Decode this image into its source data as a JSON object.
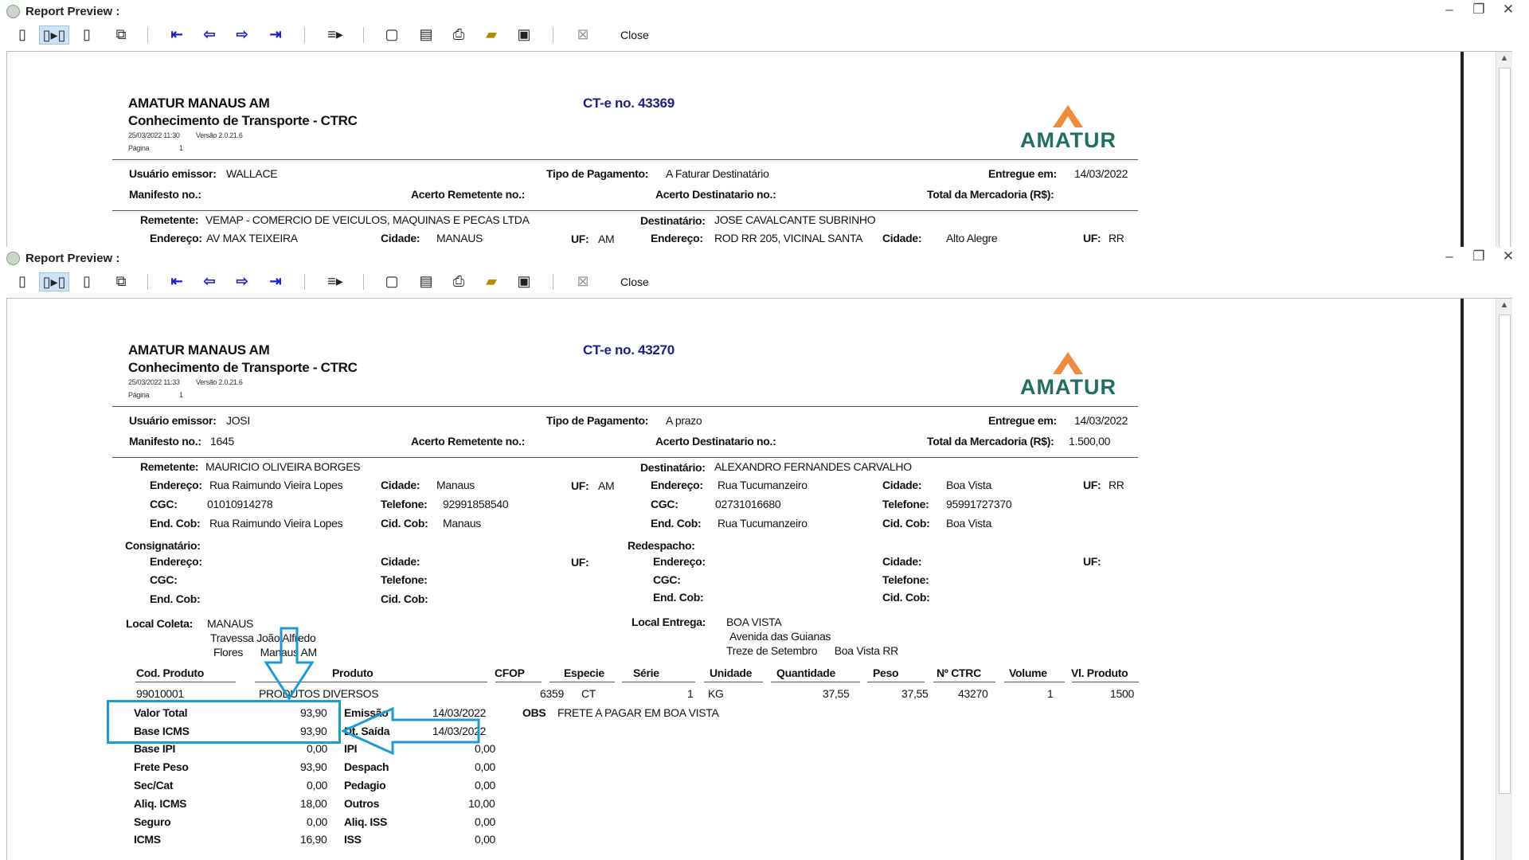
{
  "window": {
    "title": "Report Preview :",
    "close_label": "Close",
    "controls": {
      "minimize": "–",
      "restore": "❐",
      "close": "✕"
    }
  },
  "report1": {
    "company": "AMATUR MANAUS AM",
    "doc_title": "Conhecimento de Transporte - CTRC",
    "ct_number": "CT-e no. 43369",
    "datetime": "25/03/2022 11:30",
    "version": "Versão 2.0.21.6",
    "page_label": "Página",
    "page_num": "1",
    "logo_text": "AMATUR",
    "usuario_label": "Usuário emissor:",
    "usuario": "WALLACE",
    "tipo_pag_label": "Tipo de Pagamento:",
    "tipo_pag": "A Faturar Destinatário",
    "entregue_label": "Entregue em:",
    "entregue": "14/03/2022",
    "manifesto_label": "Manifesto no.:",
    "acerto_rem_label": "Acerto Remetente no.:",
    "acerto_dest_label": "Acerto Destinatario no.:",
    "total_merc_label": "Total da Mercadoria (R$):",
    "remetente_label": "Remetente:",
    "remetente": "VEMAP - COMERCIO DE VEICULOS, MAQUINAS E PECAS LTDA",
    "destinatario_label": "Destinatário:",
    "destinatario": "JOSE CAVALCANTE SUBRINHO",
    "endereco_label": "Endereço:",
    "rem_endereco": "AV MAX TEIXEIRA",
    "cidade_label": "Cidade:",
    "rem_cidade": "MANAUS",
    "uf_label": "UF:",
    "rem_uf": "AM",
    "dest_endereco": "ROD RR 205, VICINAL SANTA",
    "dest_cidade": "Alto Alegre",
    "dest_uf": "RR"
  },
  "report2": {
    "company": "AMATUR MANAUS AM",
    "doc_title": "Conhecimento de Transporte - CTRC",
    "ct_number": "CT-e no. 43270",
    "datetime": "25/03/2022 11:33",
    "version": "Versão 2.0.21.6",
    "page_label": "Página",
    "page_num": "1",
    "logo_text": "AMATUR",
    "usuario_label": "Usuário emissor:",
    "usuario": "JOSI",
    "tipo_pag_label": "Tipo de Pagamento:",
    "tipo_pag": "A prazo",
    "entregue_label": "Entregue em:",
    "entregue": "14/03/2022",
    "manifesto_label": "Manifesto no.:",
    "manifesto": "1645",
    "acerto_rem_label": "Acerto Remetente no.:",
    "acerto_dest_label": "Acerto Destinatario no.:",
    "total_merc_label": "Total da Mercadoria (R$):",
    "total_merc": "1.500,00",
    "remetente_label": "Remetente:",
    "remetente": "MAURICIO OLIVEIRA BORGES",
    "destinatario_label": "Destinatário:",
    "destinatario": "ALEXANDRO FERNANDES CARVALHO",
    "endereco_label": "Endereço:",
    "cidade_label": "Cidade:",
    "uf_label": "UF:",
    "cgc_label": "CGC:",
    "telefone_label": "Telefone:",
    "endcob_label": "End. Cob:",
    "cidcob_label": "Cid. Cob:",
    "rem": {
      "endereco": "Rua Raimundo Vieira Lopes",
      "cidade": "Manaus",
      "uf": "AM",
      "cgc": "01010914278",
      "telefone": "92991858540",
      "endcob": "Rua Raimundo Vieira Lopes",
      "cidcob": "Manaus"
    },
    "dest": {
      "endereco": "Rua Tucumanzeiro",
      "cidade": "Boa Vista",
      "uf": "RR",
      "cgc": "02731016680",
      "telefone": "95991727370",
      "endcob": "Rua Tucumanzeiro",
      "cidcob": "Boa Vista"
    },
    "consignatario_label": "Consignatário:",
    "redespacho_label": "Redespacho:",
    "local_coleta_label": "Local Coleta:",
    "local_coleta": [
      "MANAUS",
      "Travessa João Alfredo",
      "Flores      Manaus AM"
    ],
    "local_entrega_label": "Local Entrega:",
    "local_entrega": [
      "BOA VISTA",
      "Avenida das Guianas",
      "Treze de Setembro      Boa Vista RR"
    ],
    "table_headers": {
      "cod": "Cod. Produto",
      "produto": "Produto",
      "cfop": "CFOP",
      "especie": "Especie",
      "serie": "Série",
      "unidade": "Unidade",
      "quantidade": "Quantidade",
      "peso": "Peso",
      "ctrc": "Nº CTRC",
      "volume": "Volume",
      "vl_produto": "Vl. Produto"
    },
    "table_row": {
      "cod": "99010001",
      "produto": "PRODUTOS DIVERSOS",
      "cfop": "6359",
      "especie": "CT",
      "serie": "1",
      "unidade": "KG",
      "quantidade": "37,55",
      "peso": "37,55",
      "ctrc": "43270",
      "volume": "1",
      "vl_produto": "1500"
    },
    "totals_left": [
      {
        "label": "Valor Total",
        "value": "93,90"
      },
      {
        "label": "Base ICMS",
        "value": "93,90"
      },
      {
        "label": "Base IPI",
        "value": "0,00"
      },
      {
        "label": "Frete Peso",
        "value": "93,90"
      },
      {
        "label": "Sec/Cat",
        "value": "0,00"
      },
      {
        "label": "Aliq. ICMS",
        "value": "18,00"
      },
      {
        "label": "Seguro",
        "value": "0,00"
      },
      {
        "label": "ICMS",
        "value": "16,90"
      }
    ],
    "totals_right": [
      {
        "label": "Emissão",
        "value": "14/03/2022"
      },
      {
        "label": "Dt. Saída",
        "value": "14/03/2022"
      },
      {
        "label": "IPI",
        "value": "0,00"
      },
      {
        "label": "Despach",
        "value": "0,00"
      },
      {
        "label": "Pedagio",
        "value": "0,00"
      },
      {
        "label": "Outros",
        "value": "10,00"
      },
      {
        "label": "Aliq. ISS",
        "value": "0,00"
      },
      {
        "label": "ISS",
        "value": "0,00"
      }
    ],
    "obs_label": "OBS",
    "obs": "FRETE A PAGAR EM BOA VISTA"
  },
  "colors": {
    "highlight": "#1d9ad9",
    "toolbar_nav": "#1a20c8",
    "ct_number": "#1c1c8c",
    "logo_teal": "#1f6e62",
    "logo_orange": "#f08a3c"
  },
  "icons": [
    "single-page-icon",
    "two-page-icon",
    "page-width-icon",
    "multi-page-icon",
    "first-page-icon",
    "prev-page-icon",
    "next-page-icon",
    "last-page-icon",
    "goto-page-icon",
    "new-page-icon",
    "print-setup-icon",
    "print-icon",
    "open-icon",
    "save-icon",
    "export-icon"
  ]
}
